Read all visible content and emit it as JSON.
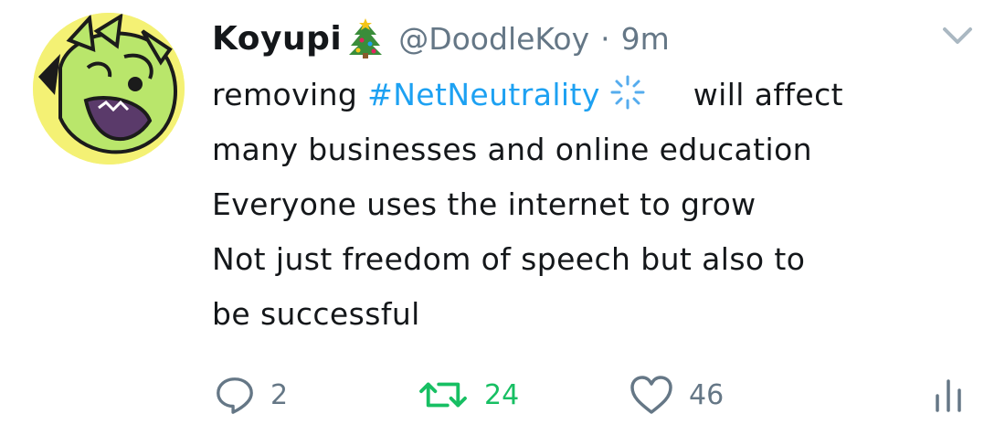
{
  "tweet": {
    "display_name": "Koyupi",
    "handle": "@DoodleKoy",
    "separator": "·",
    "time": "9m",
    "text": {
      "line1_before": "removing ",
      "hashtag": "#NetNeutrality",
      "line1_after": "will affect",
      "line2": "many businesses and online education",
      "line3": "Everyone uses the internet to grow",
      "line4": "Not just freedom of speech but also to",
      "line5": "be successful"
    },
    "actions": {
      "replies": "2",
      "retweets": "24",
      "likes": "46"
    },
    "colors": {
      "text": "#14171a",
      "muted": "#657786",
      "link": "#1da1f2",
      "retweeted": "#17bf63"
    },
    "icons": {
      "name_emoji": "christmas-tree-icon",
      "hashtag_emoji": "sparkle-icon",
      "menu": "chevron-down-icon",
      "reply": "reply-icon",
      "retweet": "retweet-icon",
      "like": "heart-icon",
      "analytics": "analytics-icon"
    }
  }
}
